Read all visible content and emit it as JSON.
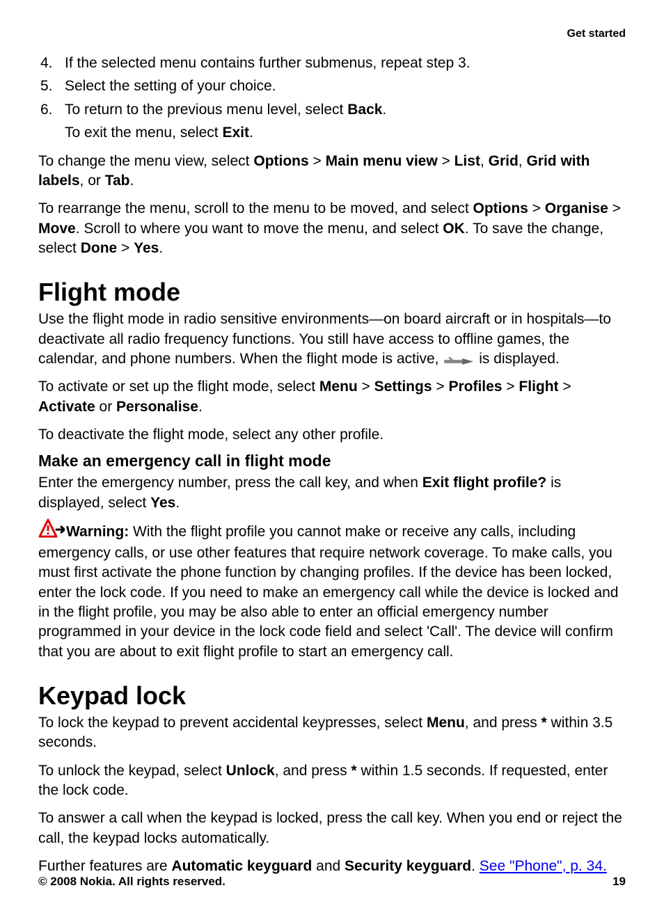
{
  "header": {
    "section": "Get started"
  },
  "list": {
    "item4": {
      "num": "4.",
      "text": "If the selected menu contains further submenus, repeat step 3."
    },
    "item5": {
      "num": "5.",
      "text": "Select the setting of your choice."
    },
    "item6": {
      "num": "6.",
      "text_pre": "To return to the previous menu level, select ",
      "bold1": "Back",
      "text_post": ".",
      "sub_pre": "To exit the menu, select ",
      "sub_bold": "Exit",
      "sub_post": "."
    }
  },
  "para1": {
    "t1": "To change the menu view, select ",
    "b1": "Options",
    "t2": " > ",
    "b2": "Main menu view",
    "t3": " > ",
    "b3": "List",
    "t4": ", ",
    "b4": "Grid",
    "t5": ", ",
    "b5": "Grid with labels",
    "t6": ", or ",
    "b6": "Tab",
    "t7": "."
  },
  "para2": {
    "t1": "To rearrange the menu, scroll to the menu to be moved, and select ",
    "b1": "Options",
    "t2": " > ",
    "b2": "Organise",
    "t3": " > ",
    "b3": "Move",
    "t4": ". Scroll to where you want to move the menu, and select ",
    "b4": "OK",
    "t5": ". To save the change, select ",
    "b5": "Done",
    "t6": " > ",
    "b6": "Yes",
    "t7": "."
  },
  "flight": {
    "heading": "Flight mode",
    "p1a": "Use the flight mode in radio sensitive environments—on board aircraft or in hospitals—to deactivate all radio frequency functions. You still have access to offline games, the calendar, and phone numbers. When the flight mode is active, ",
    "p1b": " is displayed.",
    "p2_t1": "To activate or set up the flight mode, select ",
    "p2_b1": "Menu",
    "p2_t2": " > ",
    "p2_b2": "Settings",
    "p2_t3": " > ",
    "p2_b3": "Profiles",
    "p2_t4": " > ",
    "p2_b4": "Flight",
    "p2_t5": " > ",
    "p2_b5": "Activate",
    "p2_t6": " or ",
    "p2_b6": "Personalise",
    "p2_t7": ".",
    "p3": "To deactivate the flight mode, select any other profile.",
    "sub_heading": "Make an emergency call in flight mode",
    "p4_t1": "Enter the emergency number, press the call key, and when ",
    "p4_b1": "Exit flight profile?",
    "p4_t2": " is displayed, select ",
    "p4_b2": "Yes",
    "p4_t3": "."
  },
  "warning": {
    "label": "Warning:",
    "text": " With the flight profile you cannot make or receive any calls, including emergency calls, or use other features that require network coverage. To make calls, you must first activate the phone function by changing profiles. If the device has been locked, enter the lock code. If you need to make an emergency call while the device is locked and in the flight profile, you may be also able to enter an official emergency number programmed in your device in the lock code field and select 'Call'. The device will confirm that you are about to exit flight profile to start an emergency call."
  },
  "keypad": {
    "heading": "Keypad lock",
    "p1_t1": "To lock the keypad to prevent accidental keypresses, select ",
    "p1_b1": "Menu",
    "p1_t2": ", and press ",
    "p1_b2": "*",
    "p1_t3": " within 3.5 seconds.",
    "p2_t1": "To unlock the keypad, select ",
    "p2_b1": "Unlock",
    "p2_t2": ", and press ",
    "p2_b2": "*",
    "p2_t3": " within 1.5 seconds. If requested, enter the lock code.",
    "p3": "To answer a call when the keypad is locked, press the call key. When you end or reject the call, the keypad locks automatically.",
    "p4_t1": "Further features are ",
    "p4_b1": "Automatic keyguard",
    "p4_t2": " and ",
    "p4_b2": "Security keyguard",
    "p4_t3": ". ",
    "p4_link": "See \"Phone\", p. 34."
  },
  "footer": {
    "copyright": "© 2008 Nokia. All rights reserved.",
    "page": "19"
  }
}
